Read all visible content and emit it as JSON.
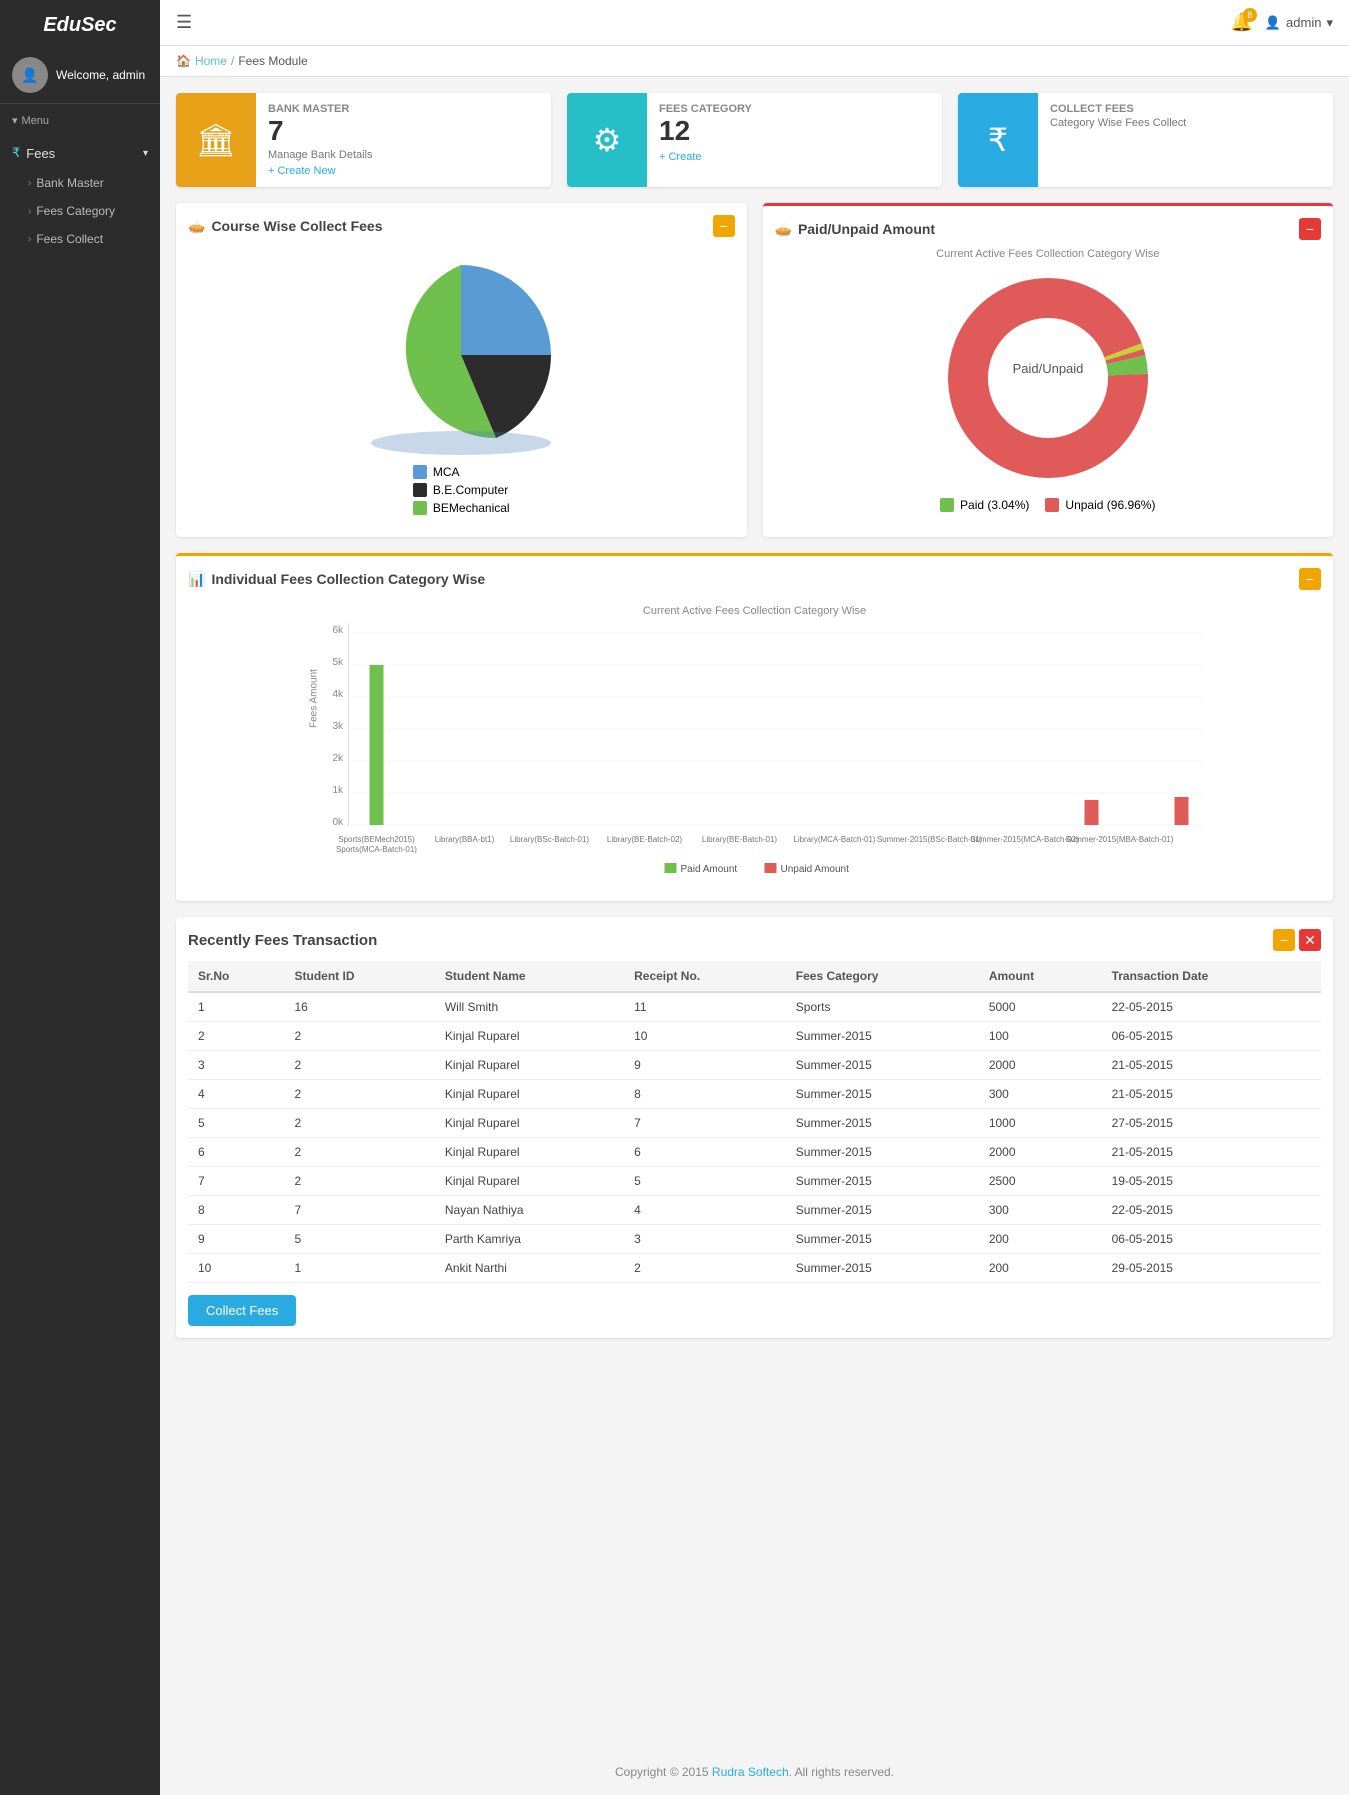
{
  "app": {
    "name": "EduSec"
  },
  "topbar": {
    "hamburger": "☰",
    "bell_count": "8",
    "user_label": "admin"
  },
  "breadcrumb": {
    "home": "Home",
    "section": "Fees Module"
  },
  "stat_cards": [
    {
      "id": "bank-master",
      "title": "BANK MASTER",
      "number": "7",
      "sub": "Manage Bank Details",
      "link": "+ Create New",
      "icon": "🏛",
      "color": "orange"
    },
    {
      "id": "fees-category",
      "title": "FEES CATEGORY",
      "number": "12",
      "sub": "",
      "link": "+ Create",
      "icon": "⚙",
      "color": "teal"
    },
    {
      "id": "collect-fees",
      "title": "COLLECT FEES",
      "number": "",
      "sub": "Category Wise Fees Collect",
      "link": "",
      "icon": "₹",
      "color": "blue"
    }
  ],
  "course_chart": {
    "title": "Course Wise Collect Fees",
    "legend": [
      {
        "label": "MCA",
        "color": "#5b9bd5"
      },
      {
        "label": "B.E.Computer",
        "color": "#2c2c2c"
      },
      {
        "label": "BEMechanical",
        "color": "#70c04e"
      }
    ]
  },
  "paid_unpaid_chart": {
    "title": "Paid/Unpaid Amount",
    "subtitle": "Current Active Fees Collection Category Wise",
    "center_label": "Paid/Unpaid",
    "legend": [
      {
        "label": "Paid (3.04%)",
        "color": "#70c04e"
      },
      {
        "label": "Unpaid (96.96%)",
        "color": "#e05a5a"
      }
    ],
    "paid_pct": 3.04,
    "unpaid_pct": 96.96
  },
  "bar_chart": {
    "title": "Individual Fees Collection Category Wise",
    "subtitle": "Current Active Fees Collection Category Wise",
    "y_labels": [
      "6k",
      "5k",
      "4k",
      "3k",
      "2k",
      "1k",
      "0k"
    ],
    "x_labels": [
      "Sports(BEMech2015)",
      "Sports(MCA-Batch-01)",
      "Library(BBA-bt1)",
      "Library(BSc-Batch-01)",
      "Library(BE-Batch-02)",
      "Library(BE-Batch-01)",
      "Library(MCA-Batch-01)",
      "Summer-2015(BSc-Batch-01)",
      "Summer-2015(MCA-Batch-02)",
      "Summer-2015(MBA-Batch-01)"
    ],
    "paid_legend": "Paid Amount",
    "unpaid_legend": "Unpaid Amount",
    "bars": [
      {
        "label": "Sports(BEMech2015)",
        "paid": 5000,
        "unpaid": 0
      },
      {
        "label": "Sports(MCA-Batch-01)",
        "paid": 0,
        "unpaid": 0
      },
      {
        "label": "Library(BBA-bt1)",
        "paid": 0,
        "unpaid": 0
      },
      {
        "label": "Library(BSc-Batch-01)",
        "paid": 0,
        "unpaid": 0
      },
      {
        "label": "Library(BE-Batch-02)",
        "paid": 0,
        "unpaid": 0
      },
      {
        "label": "Library(BE-Batch-01)",
        "paid": 0,
        "unpaid": 0
      },
      {
        "label": "Library(MCA-Batch-01)",
        "paid": 0,
        "unpaid": 0
      },
      {
        "label": "Summer-2015(BSc-Batch-01)",
        "paid": 0,
        "unpaid": 800
      },
      {
        "label": "Summer-2015(MCA-Batch-02)",
        "paid": 0,
        "unpaid": 0
      },
      {
        "label": "Summer-2015(MBA-Batch-01)",
        "paid": 0,
        "unpaid": 900
      }
    ]
  },
  "recent_table": {
    "title": "Recently Fees Transaction",
    "columns": [
      "Sr.No",
      "Student ID",
      "Student Name",
      "Receipt No.",
      "Fees Category",
      "Amount",
      "Transaction Date"
    ],
    "rows": [
      {
        "sr": "1",
        "student_id": "16",
        "student_name": "Will Smith",
        "receipt": "11",
        "category": "Sports",
        "amount": "5000",
        "date": "22-05-2015"
      },
      {
        "sr": "2",
        "student_id": "2",
        "student_name": "Kinjal Ruparel",
        "receipt": "10",
        "category": "Summer-2015",
        "amount": "100",
        "date": "06-05-2015"
      },
      {
        "sr": "3",
        "student_id": "2",
        "student_name": "Kinjal Ruparel",
        "receipt": "9",
        "category": "Summer-2015",
        "amount": "2000",
        "date": "21-05-2015"
      },
      {
        "sr": "4",
        "student_id": "2",
        "student_name": "Kinjal Ruparel",
        "receipt": "8",
        "category": "Summer-2015",
        "amount": "300",
        "date": "21-05-2015"
      },
      {
        "sr": "5",
        "student_id": "2",
        "student_name": "Kinjal Ruparel",
        "receipt": "7",
        "category": "Summer-2015",
        "amount": "1000",
        "date": "27-05-2015"
      },
      {
        "sr": "6",
        "student_id": "2",
        "student_name": "Kinjal Ruparel",
        "receipt": "6",
        "category": "Summer-2015",
        "amount": "2000",
        "date": "21-05-2015"
      },
      {
        "sr": "7",
        "student_id": "2",
        "student_name": "Kinjal Ruparel",
        "receipt": "5",
        "category": "Summer-2015",
        "amount": "2500",
        "date": "19-05-2015"
      },
      {
        "sr": "8",
        "student_id": "7",
        "student_name": "Nayan Nathiya",
        "receipt": "4",
        "category": "Summer-2015",
        "amount": "300",
        "date": "22-05-2015"
      },
      {
        "sr": "9",
        "student_id": "5",
        "student_name": "Parth Kamriya",
        "receipt": "3",
        "category": "Summer-2015",
        "amount": "200",
        "date": "06-05-2015"
      },
      {
        "sr": "10",
        "student_id": "1",
        "student_name": "Ankit Narthi",
        "receipt": "2",
        "category": "Summer-2015",
        "amount": "200",
        "date": "29-05-2015"
      }
    ]
  },
  "collect_fees_btn": "Collect Fees",
  "footer": {
    "text": "Copyright © 2015 ",
    "company": "Rudra Softech",
    "suffix": ". All rights reserved."
  },
  "sidebar": {
    "menu_label": "Menu",
    "fees_label": "Fees",
    "items": [
      {
        "label": "Bank Master"
      },
      {
        "label": "Fees Category"
      },
      {
        "label": "Fees Collect"
      }
    ]
  }
}
